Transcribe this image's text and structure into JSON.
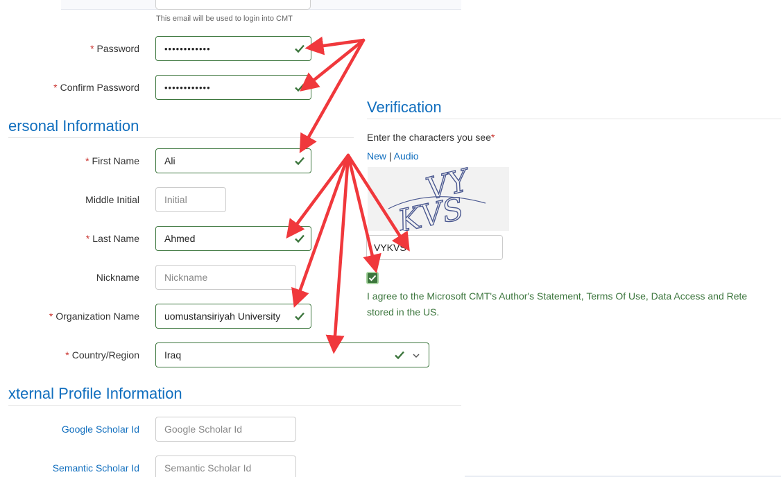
{
  "account": {
    "email_help": "This email will be used to login into CMT",
    "password": {
      "label": "Password",
      "required_mark": "*",
      "value": "••••••••••••"
    },
    "confirm_password": {
      "label": "Confirm Password",
      "required_mark": "*",
      "value": "••••••••••••"
    }
  },
  "personal": {
    "title": "ersonal Information",
    "first_name": {
      "label": "First Name",
      "required_mark": "*",
      "value": "Ali"
    },
    "middle_initial": {
      "label": "Middle Initial",
      "placeholder": "Initial"
    },
    "last_name": {
      "label": "Last Name",
      "required_mark": "*",
      "value": "Ahmed"
    },
    "nickname": {
      "label": "Nickname",
      "placeholder": "Nickname"
    },
    "organization": {
      "label": "Organization Name",
      "required_mark": "*",
      "value": "uomustansiriyah University"
    },
    "country": {
      "label": "Country/Region",
      "required_mark": "*",
      "value": "Iraq"
    }
  },
  "external": {
    "title": "xternal Profile Information",
    "google_scholar": {
      "label": "Google Scholar Id",
      "placeholder": "Google Scholar Id"
    },
    "semantic_scholar": {
      "label": "Semantic Scholar Id",
      "placeholder": "Semantic Scholar Id"
    }
  },
  "verification": {
    "title": "Verification",
    "prompt": "Enter the characters you see",
    "required_mark": "*",
    "link_new": "New",
    "separator": "|",
    "link_audio": "Audio",
    "captcha_text": "VYKVS",
    "captcha_value": "VYKVS",
    "agree_text_line1": "I agree to the Microsoft CMT's Author's Statement, Terms Of Use, Data Access and Rete",
    "agree_text_line2": "stored in the US."
  },
  "colors": {
    "accent": "#106ebe",
    "valid": "#3c763d",
    "required": "#c9302c",
    "arrow": "#f0383c"
  },
  "icons": {
    "valid_check": "check-icon",
    "dropdown": "chevron-down-icon",
    "annotation": "red-arrow"
  }
}
